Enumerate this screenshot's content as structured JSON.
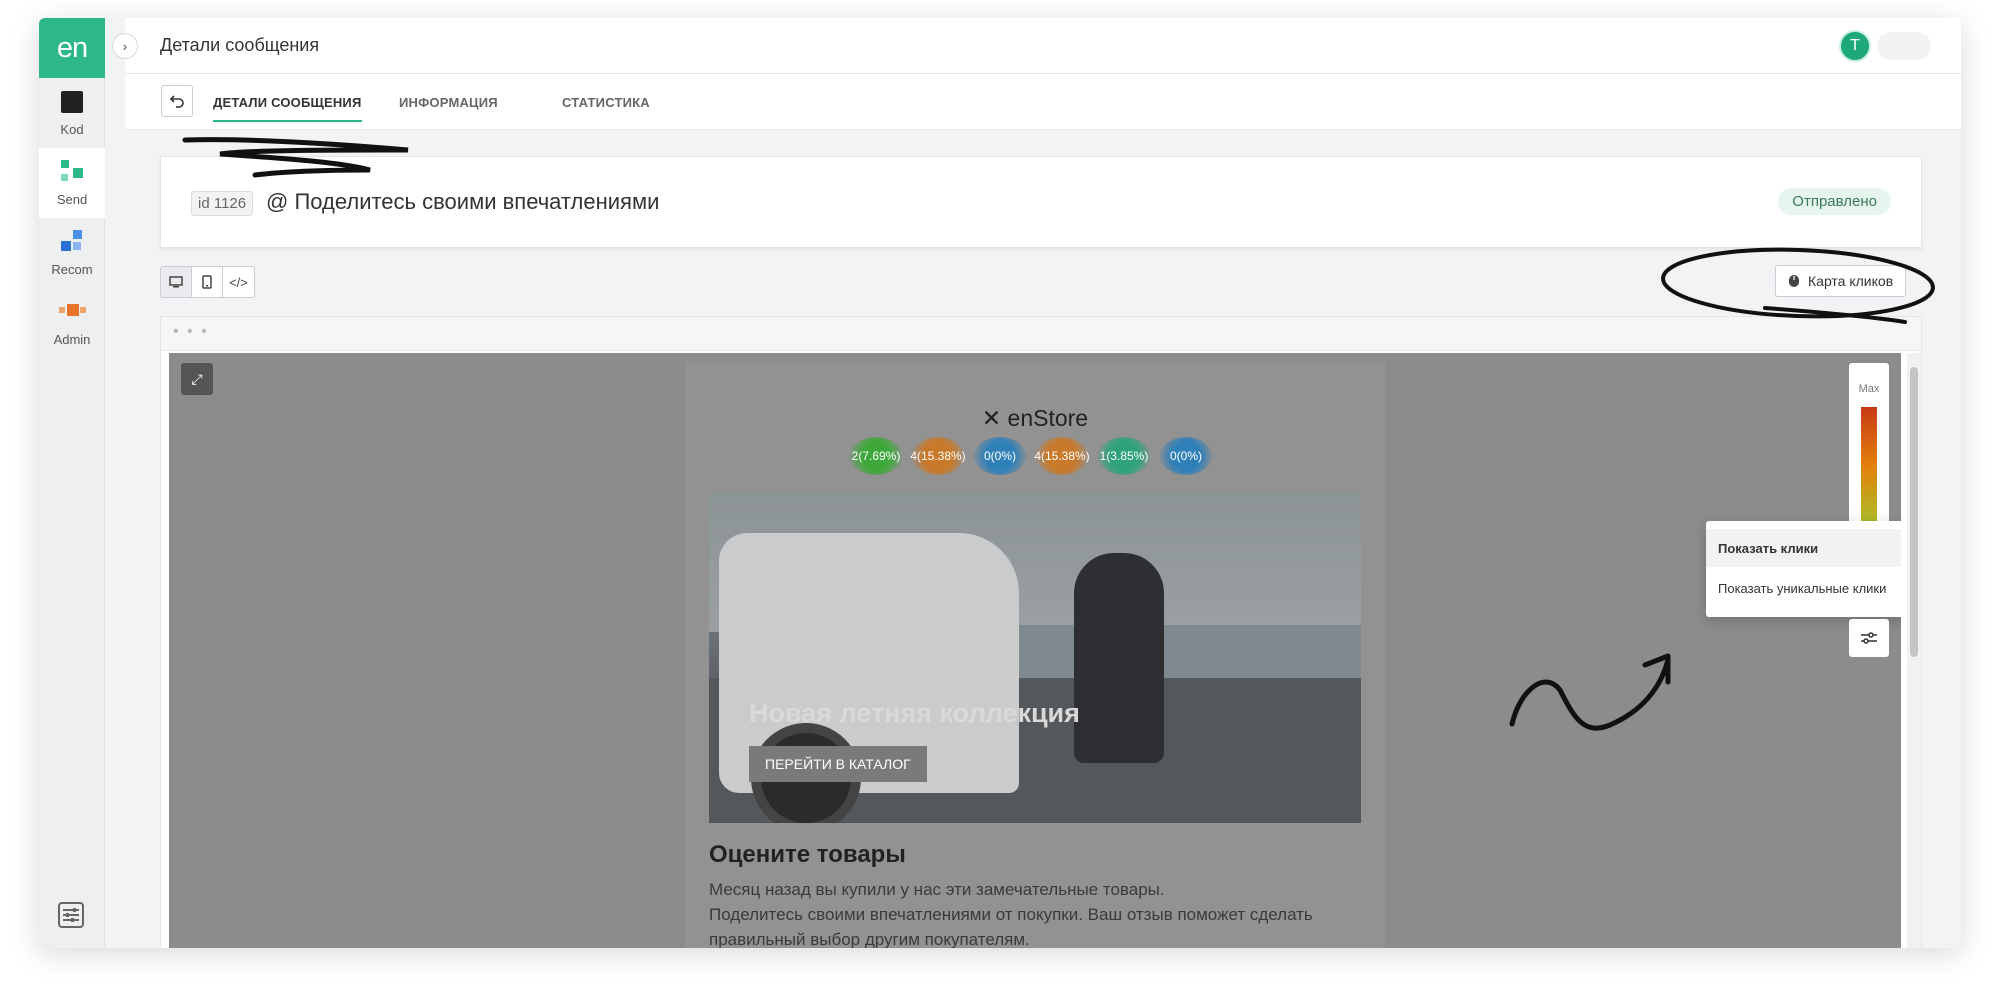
{
  "sidebar": {
    "logo": "en",
    "items": [
      {
        "label": "Kod",
        "icon": "kod-square-icon"
      },
      {
        "label": "Send",
        "icon": "send-blocks-icon"
      },
      {
        "label": "Recom",
        "icon": "recom-blocks-icon"
      },
      {
        "label": "Admin",
        "icon": "admin-blocks-icon"
      }
    ],
    "bottom_icon": "settings-sliders-icon"
  },
  "header": {
    "title": "Детали сообщения",
    "avatar_initial": "T"
  },
  "tabs": [
    {
      "label": "ДЕТАЛИ СООБЩЕНИЯ",
      "active": true
    },
    {
      "label": "ИНФОРМАЦИЯ",
      "active": false
    },
    {
      "label": "СТАТИСТИКА",
      "active": false
    }
  ],
  "message": {
    "id": "id 1126",
    "title": "@ Поделитесь своими впечатлениями",
    "status": "Отправлено"
  },
  "toolbar": {
    "heatmap_label": "Карта кликов"
  },
  "email": {
    "brand": "enStore",
    "clicks": [
      "2(7.69%)",
      "4(15.38%)",
      "0(0%)",
      "4(15.38%)",
      "1(3.85%)",
      "0(0%)"
    ],
    "hero_title": "Новая летняя коллекция",
    "hero_button": "ПЕРЕЙТИ В КАТАЛОГ",
    "heading": "Оцените товары",
    "text_line1": "Месяц назад вы купили у нас эти замечательные товары.",
    "text_line2": "Поделитесь своими впечатлениями от покупки. Ваш отзыв поможет сделать правильный выбор другим покупателям."
  },
  "heatmap": {
    "scale_label": "Max",
    "menu": [
      {
        "label": "Показать клики",
        "selected": true
      },
      {
        "label": "Показать уникальные клики",
        "selected": false
      }
    ]
  },
  "colors": {
    "brand_green": "#2db88a",
    "click_green": "#3ea83a",
    "click_orange": "#c8792a",
    "click_blue": "#2f7fb8",
    "click_teal": "#2ea37a"
  }
}
